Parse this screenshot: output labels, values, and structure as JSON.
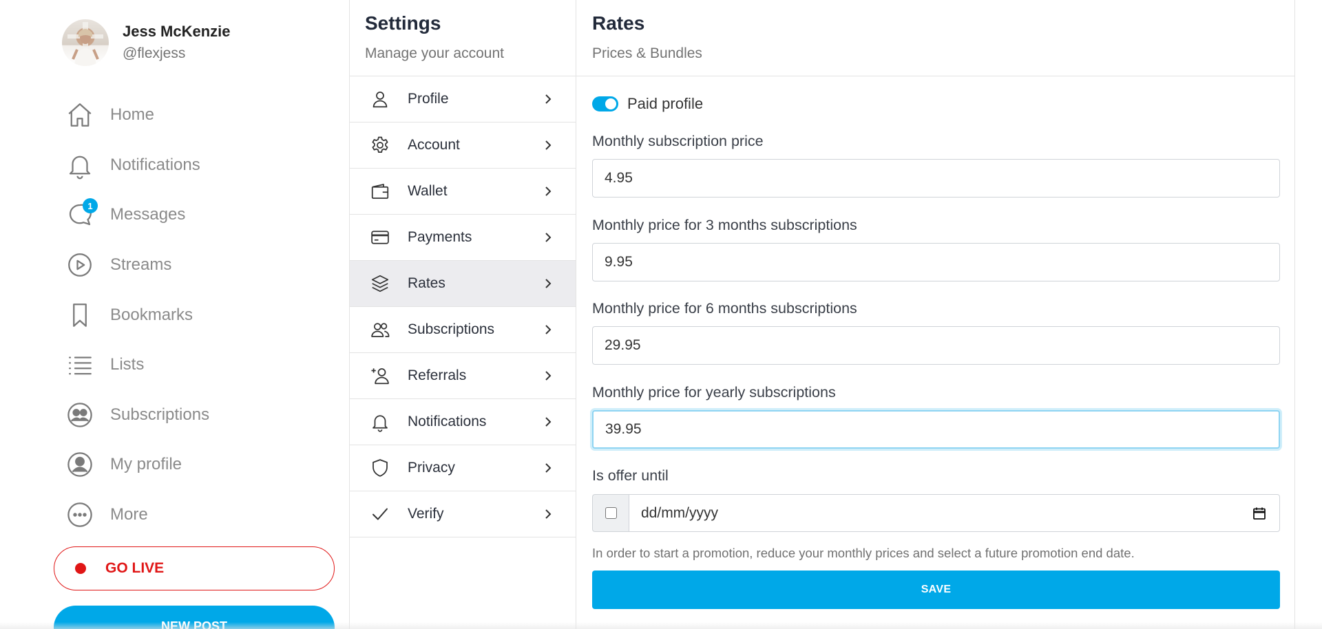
{
  "user": {
    "name": "Jess McKenzie",
    "handle": "@flexjess"
  },
  "nav": {
    "items": [
      {
        "label": "Home",
        "icon": "home-icon"
      },
      {
        "label": "Notifications",
        "icon": "bell-icon"
      },
      {
        "label": "Messages",
        "icon": "chat-icon",
        "badge": "1"
      },
      {
        "label": "Streams",
        "icon": "play-circle-icon"
      },
      {
        "label": "Bookmarks",
        "icon": "bookmark-icon"
      },
      {
        "label": "Lists",
        "icon": "list-icon"
      },
      {
        "label": "Subscriptions",
        "icon": "subscriptions-icon"
      },
      {
        "label": "My profile",
        "icon": "user-circle-icon"
      },
      {
        "label": "More",
        "icon": "more-circle-icon"
      }
    ],
    "go_live": "GO LIVE",
    "new_post": "NEW POST"
  },
  "settings": {
    "title": "Settings",
    "subtitle": "Manage your account",
    "items": [
      {
        "label": "Profile",
        "icon": "user-icon"
      },
      {
        "label": "Account",
        "icon": "gear-icon"
      },
      {
        "label": "Wallet",
        "icon": "wallet-icon"
      },
      {
        "label": "Payments",
        "icon": "credit-card-icon"
      },
      {
        "label": "Rates",
        "icon": "layers-icon",
        "active": true
      },
      {
        "label": "Subscriptions",
        "icon": "users-icon"
      },
      {
        "label": "Referrals",
        "icon": "user-plus-icon"
      },
      {
        "label": "Notifications",
        "icon": "bell-icon"
      },
      {
        "label": "Privacy",
        "icon": "shield-icon"
      },
      {
        "label": "Verify",
        "icon": "check-icon"
      }
    ]
  },
  "rates": {
    "title": "Rates",
    "subtitle": "Prices & Bundles",
    "paid_profile_label": "Paid profile",
    "paid_profile_on": true,
    "fields": [
      {
        "label": "Monthly subscription price",
        "value": "4.95"
      },
      {
        "label": "Monthly price for 3 months subscriptions",
        "value": "9.95"
      },
      {
        "label": "Monthly price for 6 months subscriptions",
        "value": "29.95"
      },
      {
        "label": "Monthly price for yearly subscriptions",
        "value": "39.95"
      }
    ],
    "offer_label": "Is offer until",
    "offer_date_placeholder": "dd/mm/yyyy",
    "help_text": "In order to start a promotion, reduce your monthly prices and select a future promotion end date.",
    "save_label": "SAVE"
  },
  "colors": {
    "accent": "#00a8e8",
    "live": "#e01616",
    "active_bg": "#ececef"
  }
}
